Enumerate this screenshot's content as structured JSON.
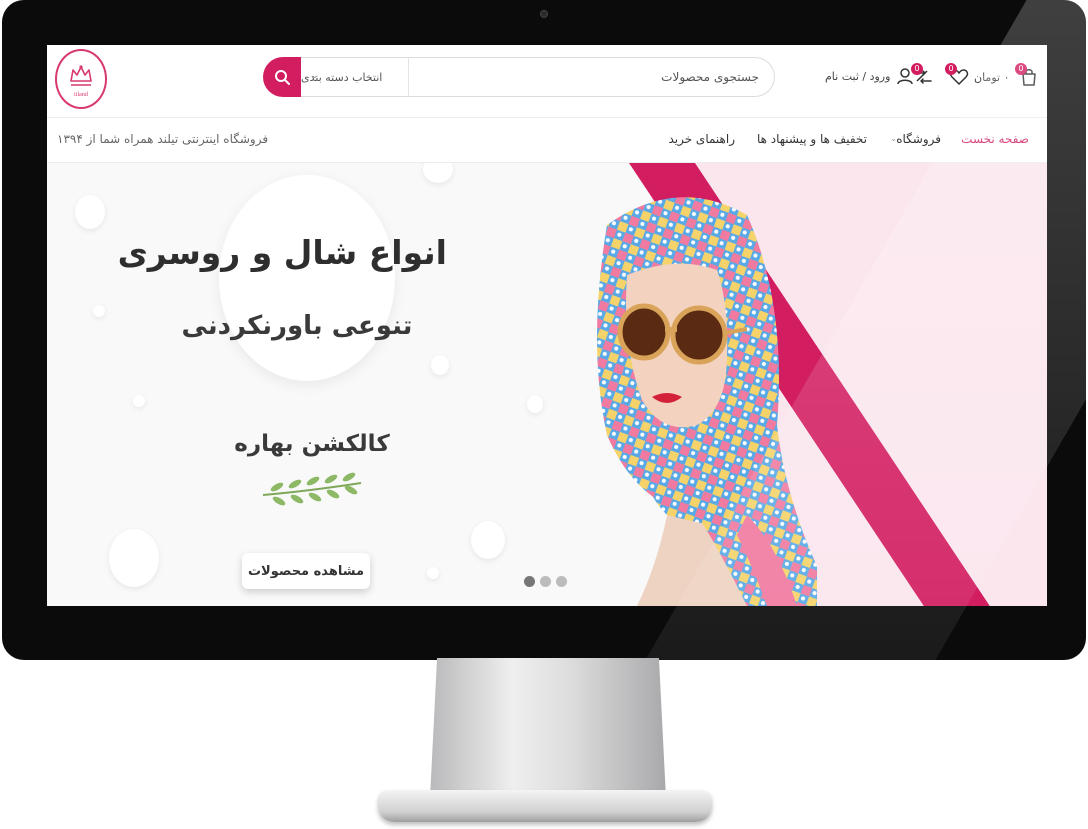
{
  "logo": {
    "text": "tiland"
  },
  "header": {
    "search_placeholder": "جستجوی محصولات",
    "category_select": "انتخاب دسته بندی",
    "login_label": "ورود / ثبت نام",
    "compare_count": "0",
    "wishlist_count": "0",
    "cart_count": "0",
    "cart_total": "۰ تومان"
  },
  "nav": {
    "items": [
      {
        "label": "صفحه نخست"
      },
      {
        "label": "فروشگاه"
      },
      {
        "label": "تخفیف ها و پیشنهاد ها"
      },
      {
        "label": "راهنمای خرید"
      }
    ],
    "tagline": "فروشگاه اینترنتی تیلند همراه شما از ۱۳۹۴"
  },
  "hero": {
    "title": "انواع شال و روسری",
    "subtitle": "تنوعی باورنکردنی",
    "collection": "کالکشن بهاره",
    "button_label": "مشاهده محصولات",
    "slide_count": 3,
    "active_slide": 1
  },
  "colors": {
    "accent": "#d21d61",
    "pink_bg": "#fbe6ee",
    "text_dark": "#2e2e2e"
  },
  "icons": [
    "search-icon",
    "user-icon",
    "compare-icon",
    "heart-icon",
    "cart-icon",
    "chevron-down-icon",
    "leaf-branch-icon"
  ]
}
